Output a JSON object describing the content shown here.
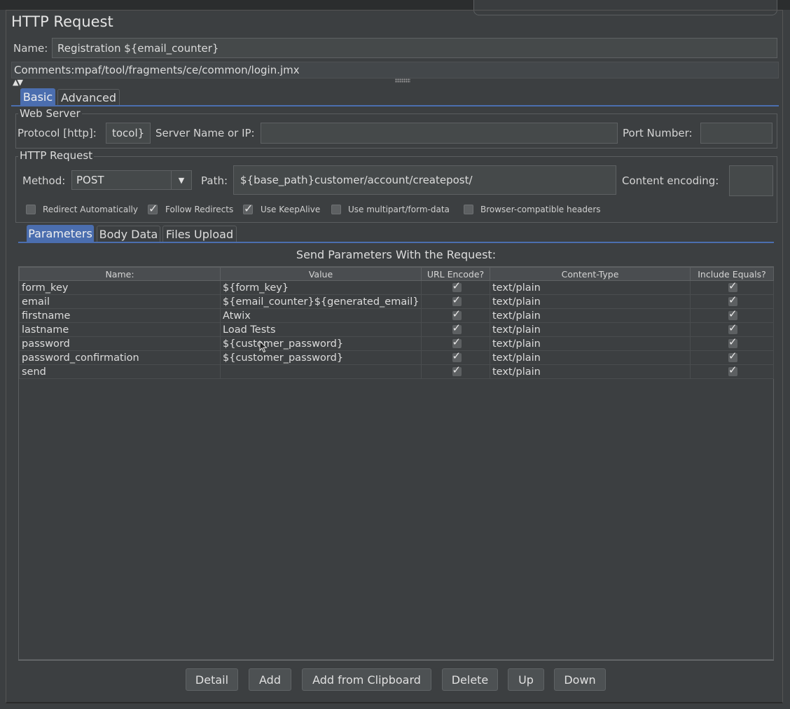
{
  "panel": {
    "title": "HTTP Request",
    "name_label": "Name:",
    "name_value": "Registration ${email_counter}",
    "comments_label": "Comments:",
    "comments_value": "mpaf/tool/fragments/ce/common/login.jmx"
  },
  "main_tabs": [
    {
      "label": "Basic",
      "active": true
    },
    {
      "label": "Advanced",
      "active": false
    }
  ],
  "web_server": {
    "legend": "Web Server",
    "protocol_label": "Protocol [http]:",
    "protocol_value": "tocol}",
    "server_label": "Server Name or IP:",
    "server_value": "",
    "port_label": "Port Number:",
    "port_value": ""
  },
  "http_request": {
    "legend": "HTTP Request",
    "method_label": "Method:",
    "method_value": "POST",
    "path_label": "Path:",
    "path_value": "${base_path}customer/account/createpost/",
    "encoding_label": "Content encoding:",
    "encoding_value": ""
  },
  "options": [
    {
      "label": "Redirect Automatically",
      "checked": false
    },
    {
      "label": "Follow Redirects",
      "checked": true
    },
    {
      "label": "Use KeepAlive",
      "checked": true
    },
    {
      "label": "Use multipart/form-data",
      "checked": false
    },
    {
      "label": "Browser-compatible headers",
      "checked": false
    }
  ],
  "sub_tabs": [
    {
      "label": "Parameters",
      "active": true
    },
    {
      "label": "Body Data",
      "active": false
    },
    {
      "label": "Files Upload",
      "active": false
    }
  ],
  "params_table": {
    "caption": "Send Parameters With the Request:",
    "columns": [
      "Name:",
      "Value",
      "URL Encode?",
      "Content-Type",
      "Include Equals?"
    ],
    "rows": [
      {
        "name": "form_key",
        "value": "${form_key}",
        "url_encode": true,
        "content_type": "text/plain",
        "include_equals": true
      },
      {
        "name": "email",
        "value": "${email_counter}${generated_email}",
        "url_encode": true,
        "content_type": "text/plain",
        "include_equals": true
      },
      {
        "name": "firstname",
        "value": "Atwix",
        "url_encode": true,
        "content_type": "text/plain",
        "include_equals": true
      },
      {
        "name": "lastname",
        "value": "Load Tests",
        "url_encode": true,
        "content_type": "text/plain",
        "include_equals": true
      },
      {
        "name": "password",
        "value": "${customer_password}",
        "url_encode": true,
        "content_type": "text/plain",
        "include_equals": true
      },
      {
        "name": "password_confirmation",
        "value": "${customer_password}",
        "url_encode": true,
        "content_type": "text/plain",
        "include_equals": true
      },
      {
        "name": "send",
        "value": "",
        "url_encode": true,
        "content_type": "text/plain",
        "include_equals": true
      }
    ]
  },
  "buttons": {
    "detail": "Detail",
    "add": "Add",
    "add_clipboard": "Add from Clipboard",
    "delete": "Delete",
    "up": "Up",
    "down": "Down"
  },
  "colors": {
    "background": "#3c3f41",
    "accent": "#4b6eaf",
    "field": "#45494a"
  }
}
